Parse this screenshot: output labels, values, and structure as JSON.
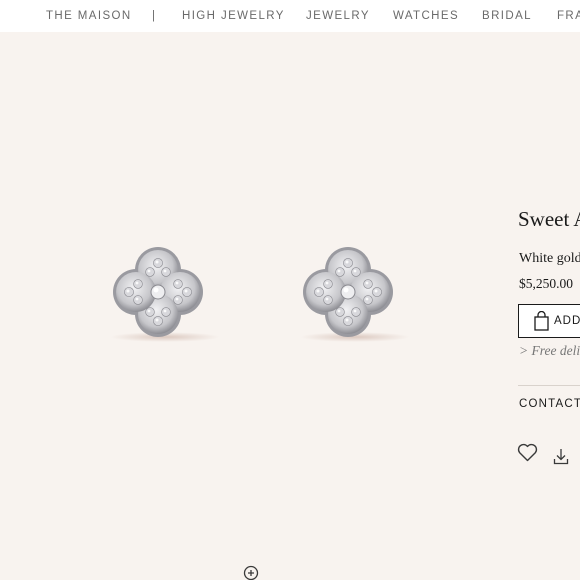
{
  "nav": {
    "items": [
      "THE MAISON",
      "|",
      "HIGH JEWELRY",
      "JEWELRY",
      "WATCHES",
      "BRIDAL",
      "FRA"
    ]
  },
  "product": {
    "title": "Sweet A",
    "material": "White gold",
    "price": "$5,250.00",
    "add_label": "ADD",
    "delivery": "> Free deli",
    "contact": "CONTACT"
  },
  "icons": {
    "bag": "shopping-bag-icon",
    "wishlist": "heart-icon",
    "download": "download-icon",
    "zoom": "zoom-in-icon"
  },
  "colors": {
    "background": "#f8f3ef",
    "nav_background": "#ffffff",
    "text": "#1a1a1a",
    "muted_text": "#6a6a6a",
    "metal": "#c9c9cd"
  }
}
